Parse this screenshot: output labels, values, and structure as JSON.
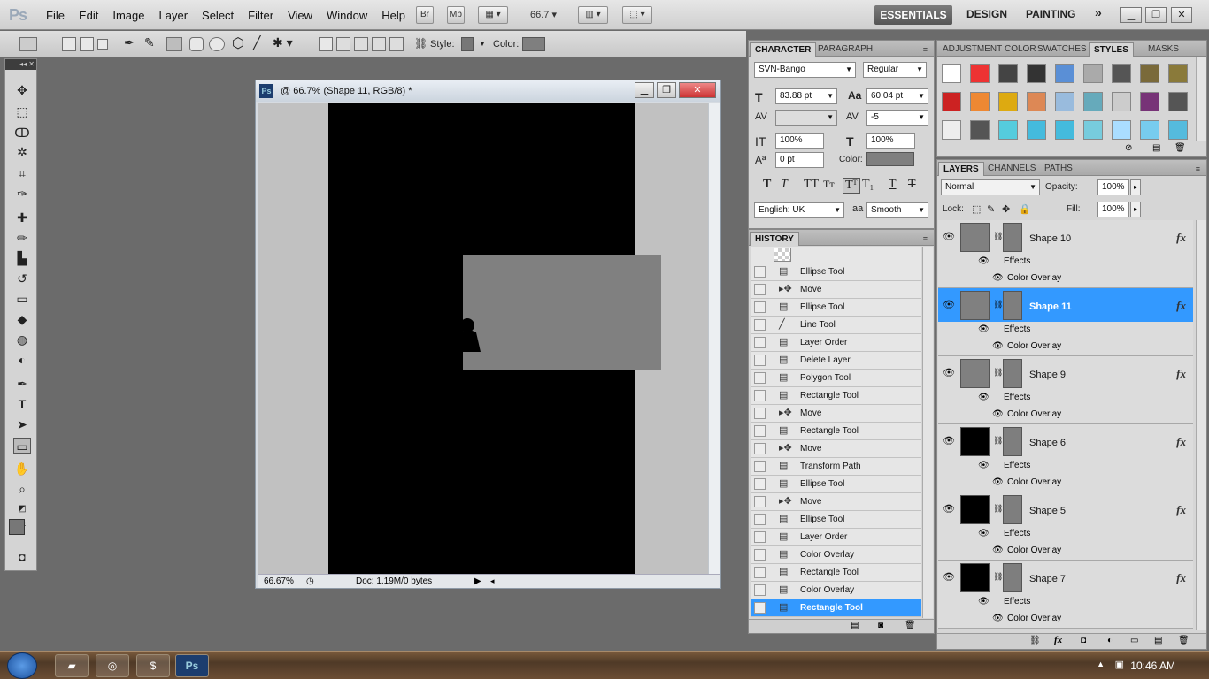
{
  "app": {
    "logo": "Ps",
    "zoom": "66.7"
  },
  "menu": [
    "File",
    "Edit",
    "Image",
    "Layer",
    "Select",
    "Filter",
    "View",
    "Window",
    "Help"
  ],
  "appbar": {
    "bridge": "Br",
    "minibridge": "Mb"
  },
  "workspaces": {
    "essentials": "ESSENTIALS",
    "design": "DESIGN",
    "painting": "PAINTING",
    "more": "»"
  },
  "options": {
    "style_label": "Style:",
    "color_label": "Color:"
  },
  "document": {
    "title": "@ 66.7% (Shape 11, RGB/8) *",
    "zoom": "66.67%",
    "doc_size": "Doc: 1.19M/0 bytes"
  },
  "character": {
    "tabs": [
      "CHARACTER",
      "PARAGRAPH"
    ],
    "font_family": "SVN-Bango",
    "font_style": "Regular",
    "size": "83.88 pt",
    "leading": "60.04 pt",
    "kerning": "",
    "tracking": "-5",
    "vscale": "100%",
    "hscale": "100%",
    "baseline": "0 pt",
    "color_label": "Color:",
    "language": "English: UK",
    "aa_icon": "a",
    "antialias": "Smooth"
  },
  "history": {
    "title": "HISTORY",
    "items": [
      "Ellipse Tool",
      "Move",
      "Ellipse Tool",
      "Line Tool",
      "Layer Order",
      "Delete Layer",
      "Polygon Tool",
      "Rectangle Tool",
      "Move",
      "Rectangle Tool",
      "Move",
      "Transform Path",
      "Ellipse Tool",
      "Move",
      "Ellipse Tool",
      "Layer Order",
      "Color Overlay",
      "Rectangle Tool",
      "Color Overlay",
      "Rectangle Tool"
    ],
    "selected": "Rectangle Tool"
  },
  "styles_panel": {
    "tabs": [
      "ADJUSTMENT",
      "COLOR",
      "SWATCHES",
      "STYLES",
      "MASKS"
    ]
  },
  "layers_panel": {
    "tabs": [
      "LAYERS",
      "CHANNELS",
      "PATHS"
    ],
    "blend": "Normal",
    "opacity_label": "Opacity:",
    "opacity": "100%",
    "lock_label": "Lock:",
    "fill_label": "Fill:",
    "fill": "100%",
    "effects_label": "Effects",
    "overlay_label": "Color Overlay",
    "layers": [
      {
        "name": "Shape 10",
        "thumb": "#808080"
      },
      {
        "name": "Shape 11",
        "thumb": "#808080"
      },
      {
        "name": "Shape 9",
        "thumb": "#808080"
      },
      {
        "name": "Shape 6",
        "thumb": "#000000"
      },
      {
        "name": "Shape 5",
        "thumb": "#000000"
      },
      {
        "name": "Shape 7",
        "thumb": "#000000"
      }
    ],
    "selected": "Shape 11"
  },
  "taskbar": {
    "clock": "10:46 AM",
    "ps_label": "Ps"
  },
  "colors": {
    "selection": "#3399ff",
    "canvas": "#000000",
    "shape": "#808080"
  }
}
